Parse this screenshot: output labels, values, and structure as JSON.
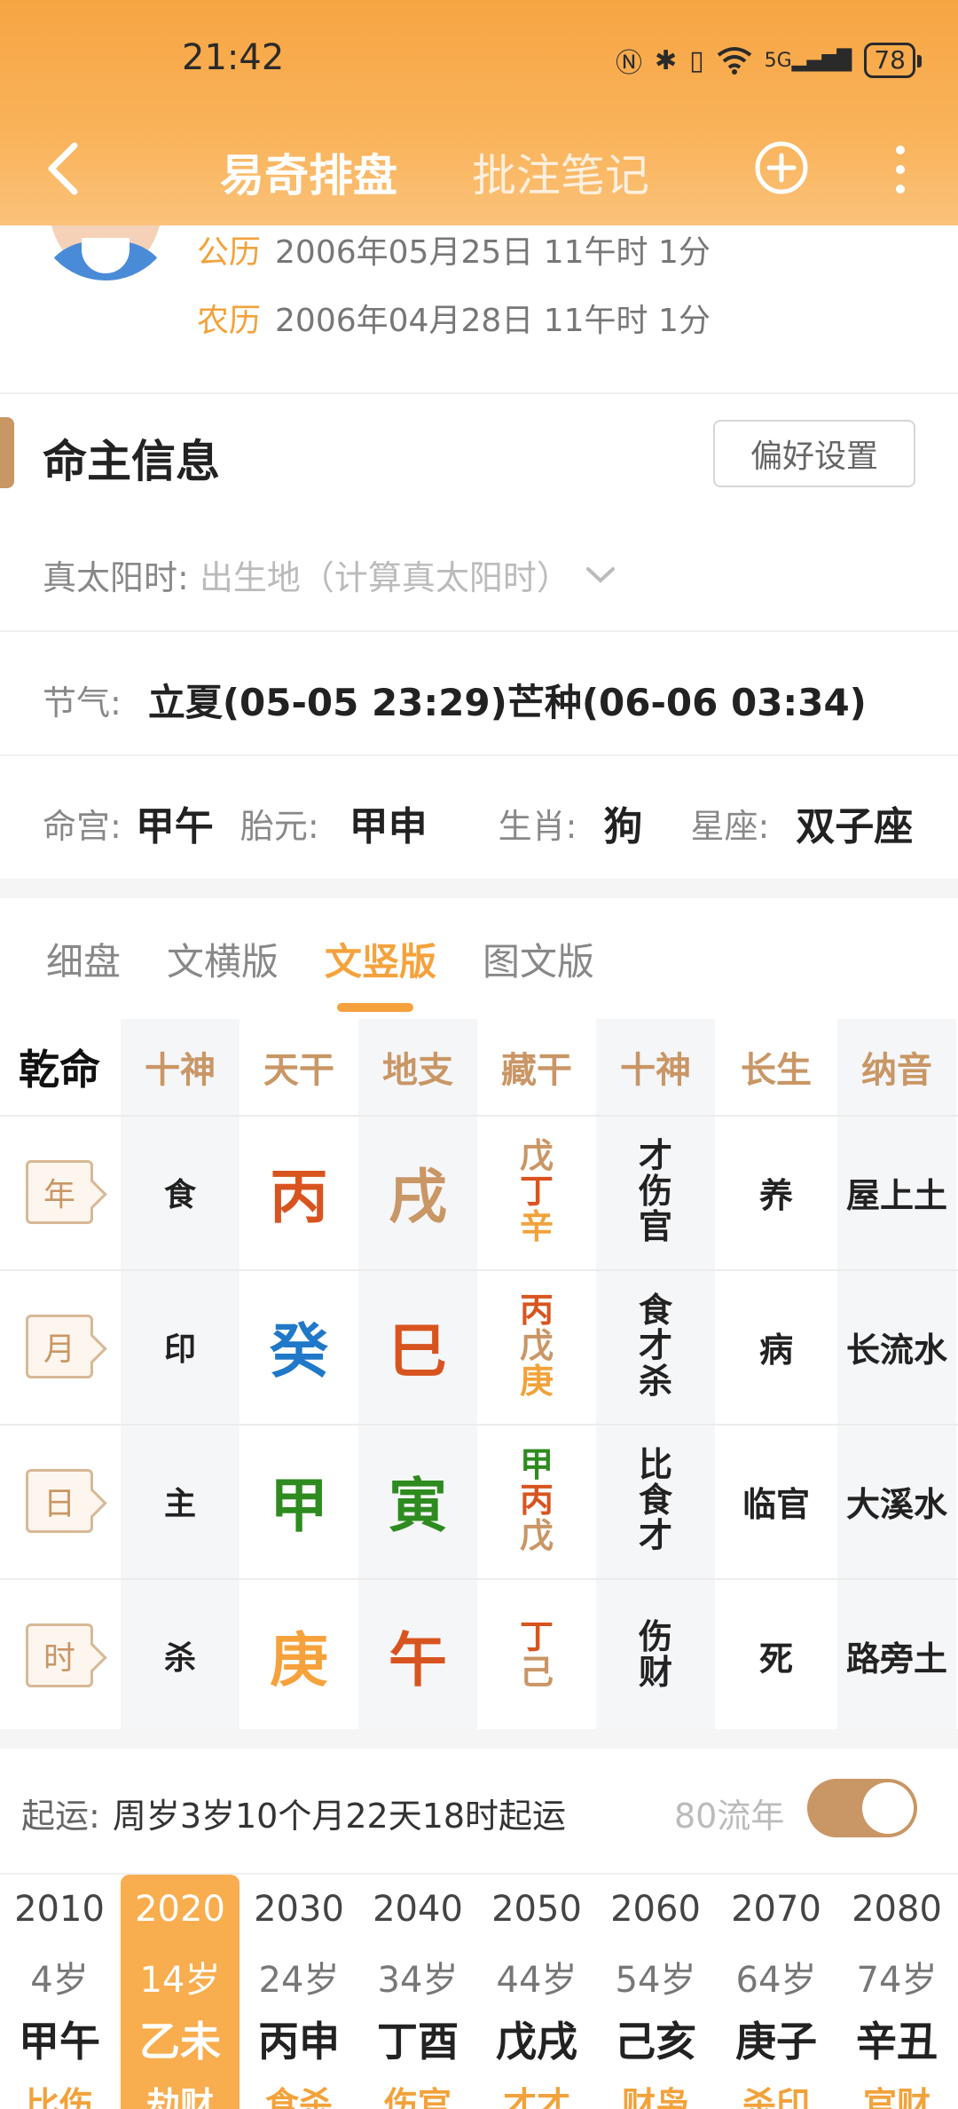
{
  "status": {
    "time": "21:42",
    "battery": "78",
    "net": "5G"
  },
  "header": {
    "title": "易奇排盘",
    "notes_tab": "批注笔记"
  },
  "birth": {
    "solar_tag": "公历",
    "solar": "2006年05月25日 11午时 1分",
    "lunar_tag": "农历",
    "lunar": "2006年04月28日 11午时 1分"
  },
  "owner": {
    "title": "命主信息",
    "pref_button": "偏好设置",
    "true_solar_label": "真太阳时:",
    "true_solar_placeholder": "出生地（计算真太阳时）",
    "jieqi_label": "节气:",
    "jieqi_value": "立夏(05-05 23:29)芒种(06-06 03:34)",
    "minggong_label": "命宫:",
    "minggong": "甲午",
    "taiyuan_label": "胎元:",
    "taiyuan": "甲申",
    "shengxiao_label": "生肖:",
    "shengxiao": "狗",
    "xingzuo_label": "星座:",
    "xingzuo": "双子座"
  },
  "chart_tabs": [
    "细盘",
    "文横版",
    "文竖版",
    "图文版"
  ],
  "chart_tab_active": "文竖版",
  "grid": {
    "headers": [
      "乾命",
      "十神",
      "天干",
      "地支",
      "藏干",
      "十神",
      "长生",
      "纳音"
    ],
    "rows": [
      {
        "pillar": "年",
        "shishen": "食",
        "gan": "丙",
        "gan_color": "#d8541f",
        "zhi": "戌",
        "zhi_color": "#c99665",
        "canggan": [
          [
            "戊",
            "#c99665"
          ],
          [
            "丁",
            "#d8541f"
          ],
          [
            "辛",
            "#f2a23a"
          ]
        ],
        "cang_shishen": [
          "才",
          "伤",
          "官"
        ],
        "changsheng": "养",
        "nayin": "屋上土"
      },
      {
        "pillar": "月",
        "shishen": "印",
        "gan": "癸",
        "gan_color": "#1f78c8",
        "zhi": "巳",
        "zhi_color": "#d8541f",
        "canggan": [
          [
            "丙",
            "#d8541f"
          ],
          [
            "戊",
            "#c99665"
          ],
          [
            "庚",
            "#f2a23a"
          ]
        ],
        "cang_shishen": [
          "食",
          "才",
          "杀"
        ],
        "changsheng": "病",
        "nayin": "长流水"
      },
      {
        "pillar": "日",
        "shishen": "主",
        "gan": "甲",
        "gan_color": "#2e8b1f",
        "zhi": "寅",
        "zhi_color": "#2e8b1f",
        "canggan": [
          [
            "甲",
            "#2e8b1f"
          ],
          [
            "丙",
            "#d8541f"
          ],
          [
            "戊",
            "#c99665"
          ]
        ],
        "cang_shishen": [
          "比",
          "食",
          "才"
        ],
        "changsheng": "临官",
        "nayin": "大溪水"
      },
      {
        "pillar": "时",
        "shishen": "杀",
        "gan": "庚",
        "gan_color": "#f6a23c",
        "zhi": "午",
        "zhi_color": "#d8541f",
        "canggan": [
          [
            "丁",
            "#d8541f"
          ],
          [
            "己",
            "#c99665"
          ]
        ],
        "cang_shishen": [
          "伤",
          "财"
        ],
        "changsheng": "死",
        "nayin": "路旁土"
      }
    ]
  },
  "qiyun": {
    "label": "起运:",
    "value": "周岁3岁10个月22天18时起运",
    "liunian": "80流年",
    "toggle_on": true
  },
  "decades": [
    {
      "year": "2010",
      "age": "4岁",
      "ganzhi": "甲午",
      "gods": "比伤"
    },
    {
      "year": "2020",
      "age": "14岁",
      "ganzhi": "乙未",
      "gods": "劫财",
      "active": true
    },
    {
      "year": "2030",
      "age": "24岁",
      "ganzhi": "丙申",
      "gods": "食杀"
    },
    {
      "year": "2040",
      "age": "34岁",
      "ganzhi": "丁酉",
      "gods": "伤官"
    },
    {
      "year": "2050",
      "age": "44岁",
      "ganzhi": "戊戌",
      "gods": "才才"
    },
    {
      "year": "2060",
      "age": "54岁",
      "ganzhi": "己亥",
      "gods": "财枭"
    },
    {
      "year": "2070",
      "age": "64岁",
      "ganzhi": "庚子",
      "gods": "杀印"
    },
    {
      "year": "2080",
      "age": "74岁",
      "ganzhi": "辛丑",
      "gods": "官财"
    }
  ]
}
